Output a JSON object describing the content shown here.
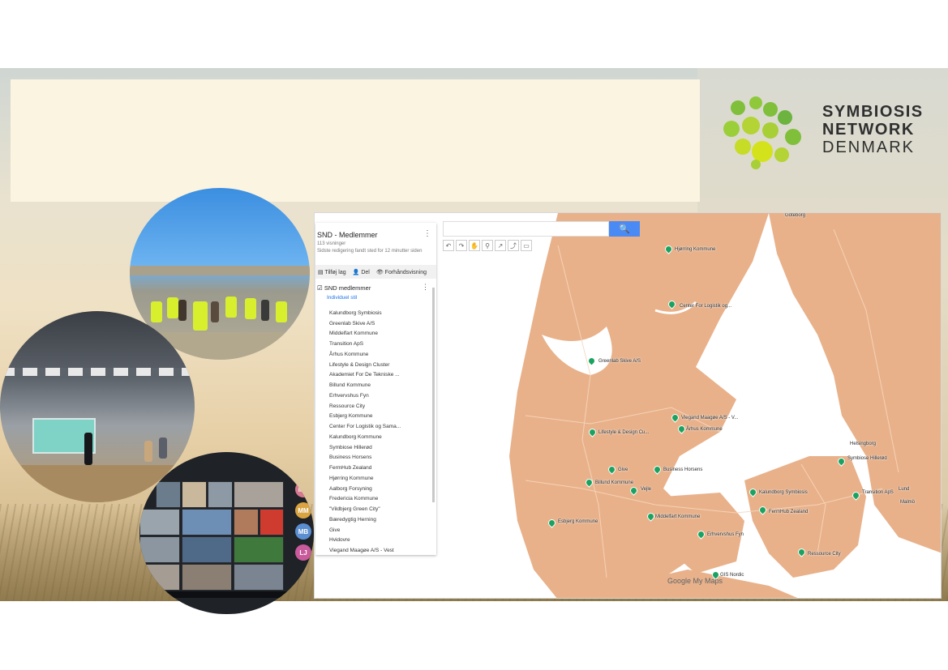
{
  "logo": {
    "line1": "SYMBIOSIS",
    "line2": "NETWORK",
    "line3": "DENMARK",
    "colors": [
      "#7fbf3a",
      "#b4d334",
      "#d4e21b"
    ]
  },
  "video_call": {
    "participants_initials": [
      "MD",
      "MM",
      "MB",
      "LJ"
    ]
  },
  "map": {
    "panel": {
      "title": "SND - Medlemmer",
      "views": "113 visninger",
      "last_edit": "Sidste redigering fandt sted for 12 minutter siden",
      "actions": [
        "Tilføj lag",
        "Del",
        "Forhåndsvisning"
      ],
      "layer_name": "SND medlemmer",
      "layer_style": "Individuel stil",
      "items": [
        "Kalundborg Symbiosis",
        "Greenlab Skive A/S",
        "Middelfart Kommune",
        "Transition ApS",
        "Århus Kommune",
        "Lifestyle & Design Cluster",
        "Akademiet For De Tekniske ...",
        "Billund Kommune",
        "Erhvervshus Fyn",
        "Ressource City",
        "Esbjerg Kommune",
        "Center For Logistik og Sama...",
        "Kalundborg Kommune",
        "Symbiose Hillerød",
        "Business Horsens",
        "FermHub Zealand",
        "Hjørring Kommune",
        "Aalborg Forsyning",
        "Fredericia Kommune",
        "\"Vildbjerg Green City\"",
        "Bæredygtig Herning",
        "Give",
        "Hvidovre",
        "Viegand Maagøe A/S - Vest"
      ]
    },
    "search_button": "🔍",
    "brand": "Google My Maps",
    "pin_color": "#1aa260",
    "pin_labels": [
      "Hjørring Kommune",
      "Center For Logistik og...",
      "Greenlab Skive A/S",
      "Viegand Maagøe A/S - V...",
      "Århus Kommune",
      "Lifestyle & Design Cu...",
      "Give",
      "Business Horsens",
      "Billund Kommune",
      "Vejle",
      "Esbjerg Kommune",
      "Middelfart Kommune",
      "Erhvervshus Fyn",
      "Kalundborg Symbiosis",
      "FermHub Zealand",
      "Symbiose Hillerød",
      "Transition ApS",
      "Ressource City",
      "Lund",
      "Malmö",
      "GIS Nordic",
      "Göteborg",
      "Helsingborg"
    ]
  }
}
